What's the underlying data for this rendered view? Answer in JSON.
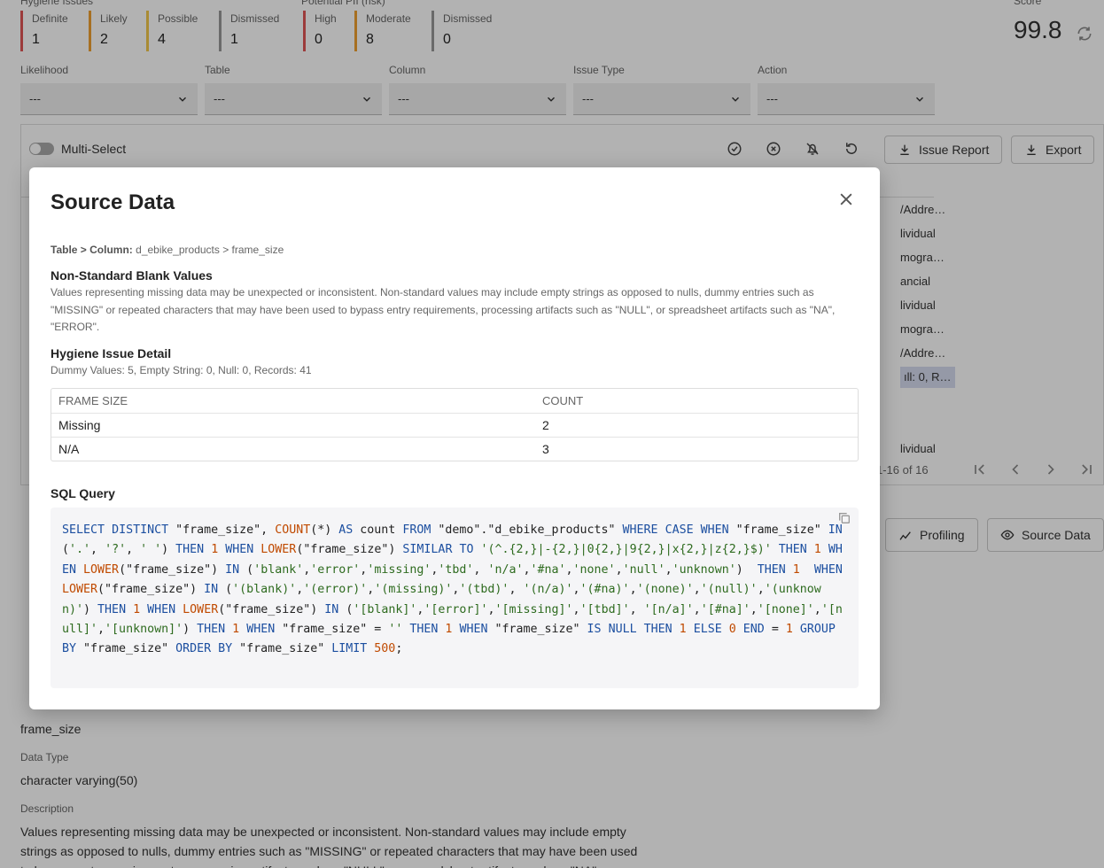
{
  "top": {
    "hygiene_caption": "Hygiene Issues",
    "pii_caption": "Potential PII (risk)",
    "hygiene_metrics": [
      {
        "label": "Definite",
        "value": "1",
        "color": "#e05555"
      },
      {
        "label": "Likely",
        "value": "2",
        "color": "#f0a030"
      },
      {
        "label": "Possible",
        "value": "4",
        "color": "#f2c84b"
      },
      {
        "label": "Dismissed",
        "value": "1",
        "color": "#999999"
      }
    ],
    "pii_metrics": [
      {
        "label": "High",
        "value": "0",
        "color": "#e05555"
      },
      {
        "label": "Moderate",
        "value": "8",
        "color": "#f0a030"
      },
      {
        "label": "Dismissed",
        "value": "0",
        "color": "#999999"
      }
    ],
    "score_caption": "Score",
    "score_value": "99.8"
  },
  "filters": [
    {
      "label": "Likelihood",
      "value": "---"
    },
    {
      "label": "Table",
      "value": "---"
    },
    {
      "label": "Column",
      "value": "---"
    },
    {
      "label": "Issue Type",
      "value": "---"
    },
    {
      "label": "Action",
      "value": "---"
    }
  ],
  "grid": {
    "multiselect_label": "Multi-Select",
    "issue_report_label": "Issue Report",
    "export_label": "Export",
    "row_fragments": [
      "/Addre…",
      "lividual",
      "mogra…",
      "ancial",
      "lividual",
      "mogra…",
      "/Addre…",
      "ıll: 0, R…",
      "lividual"
    ],
    "pager_text": "1-16 of 16",
    "profiling_label": "Profiling",
    "source_data_label": "Source Data"
  },
  "details": {
    "column_value": "frame_size",
    "data_type_label": "Data Type",
    "data_type_value": "character varying(50)",
    "description_label": "Description",
    "description_value": "Values representing missing data may be unexpected or inconsistent. Non-standard values may include empty strings as opposed to nulls, dummy entries such as \"MISSING\" or repeated characters that may have been used to bypass entry requirements, processing artifacts such as \"NULL\", or spreadsheet artifacts such as \"NA\"."
  },
  "modal": {
    "title": "Source Data",
    "crumb_label": "Table > Column:",
    "crumb_value": "d_ebike_products > frame_size",
    "issue_title": "Non-Standard Blank Values",
    "issue_description": "Values representing missing data may be unexpected or inconsistent. Non-standard values may include empty strings as opposed to nulls, dummy entries such as \"MISSING\" or repeated characters that may have been used to bypass entry requirements, processing artifacts such as \"NULL\", or spreadsheet artifacts such as \"NA\", \"ERROR\".",
    "detail_title": "Hygiene Issue Detail",
    "detail_text": "Dummy Values: 5, Empty String: 0, Null: 0, Records: 41",
    "table_headers": [
      "FRAME SIZE",
      "COUNT"
    ],
    "table_rows": [
      [
        "Missing",
        "2"
      ],
      [
        "N/A",
        "3"
      ]
    ],
    "sql_title": "SQL Query",
    "sql_query": "SELECT DISTINCT \"frame_size\", COUNT(*) AS count FROM \"demo\".\"d_ebike_products\" WHERE CASE WHEN \"frame_size\" IN ('.', '?', ' ') THEN 1 WHEN LOWER(\"frame_size\") SIMILAR TO '(^.{2,}|-{2,}|0{2,}|9{2,}|x{2,}|z{2,}$)' THEN 1 WHEN LOWER(\"frame_size\") IN ('blank','error','missing','tbd', 'n/a','#na','none','null','unknown')  THEN 1  WHEN LOWER(\"frame_size\") IN ('(blank)','(error)','(missing)','(tbd)', '(n/a)','(#na)','(none)','(null)','(unknown)') THEN 1 WHEN LOWER(\"frame_size\") IN ('[blank]','[error]','[missing]','[tbd]', '[n/a]','[#na]','[none]','[null]','[unknown]') THEN 1 WHEN \"frame_size\" = '' THEN 1 WHEN \"frame_size\" IS NULL THEN 1 ELSE 0 END = 1 GROUP BY \"frame_size\" ORDER BY \"frame_size\" LIMIT 500;"
  }
}
